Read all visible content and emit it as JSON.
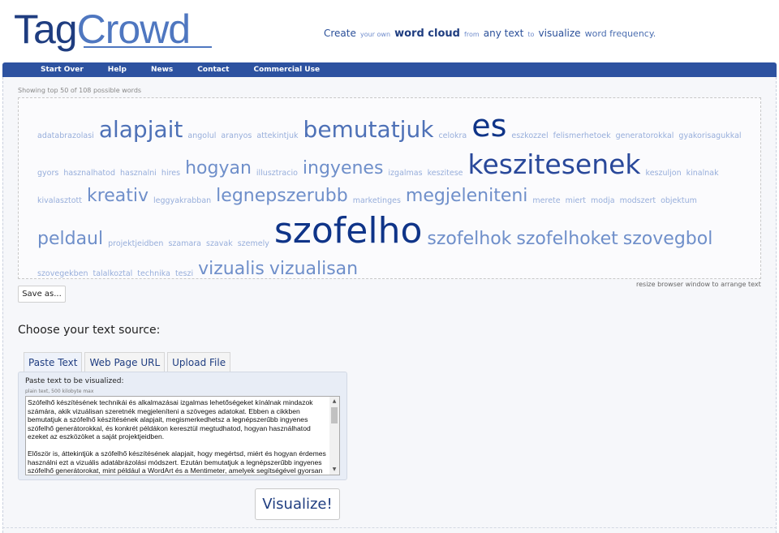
{
  "header": {
    "logo_tag": "Tag",
    "logo_crowd": "Crowd",
    "tagline": [
      {
        "text": "Create",
        "size": "xl"
      },
      {
        "text": "your own",
        "size": "sm"
      },
      {
        "text": "word cloud",
        "size": "lg"
      },
      {
        "text": "from",
        "size": "sm"
      },
      {
        "text": "any text",
        "size": "xl"
      },
      {
        "text": "to",
        "size": "sm"
      },
      {
        "text": "visualize",
        "size": "xl"
      },
      {
        "text": "word frequency.",
        "size": "md"
      }
    ]
  },
  "nav": {
    "items": [
      "Start Over",
      "Help",
      "News",
      "Contact",
      "Commercial Use"
    ]
  },
  "cloud": {
    "showing": "Showing top 50 of 108 possible words",
    "resize_note": "resize browser window to arrange text",
    "words": [
      {
        "text": "adatabrazolasi",
        "weight": 1
      },
      {
        "text": "alapjait",
        "weight": 6
      },
      {
        "text": "angolul",
        "weight": 1
      },
      {
        "text": "aranyos",
        "weight": 1
      },
      {
        "text": "attekintjuk",
        "weight": 1
      },
      {
        "text": "bemutatjuk",
        "weight": 7
      },
      {
        "text": "celokra",
        "weight": 1
      },
      {
        "text": "es",
        "weight": 9
      },
      {
        "text": "eszkozzel",
        "weight": 1
      },
      {
        "text": "felismerhetoek",
        "weight": 1
      },
      {
        "text": "generatorokkal",
        "weight": 1
      },
      {
        "text": "gyakorisagukkal",
        "weight": 1
      },
      {
        "text": "gyors",
        "weight": 1
      },
      {
        "text": "hasznalhatod",
        "weight": 1
      },
      {
        "text": "hasznalni",
        "weight": 1
      },
      {
        "text": "hires",
        "weight": 1
      },
      {
        "text": "hogyan",
        "weight": 5
      },
      {
        "text": "illusztracio",
        "weight": 1
      },
      {
        "text": "ingyenes",
        "weight": 5
      },
      {
        "text": "izgalmas",
        "weight": 1
      },
      {
        "text": "keszitese",
        "weight": 1
      },
      {
        "text": "keszitesenek",
        "weight": 8
      },
      {
        "text": "keszuljon",
        "weight": 1
      },
      {
        "text": "kinalnak",
        "weight": 1
      },
      {
        "text": "kivalasztott",
        "weight": 1
      },
      {
        "text": "kreativ",
        "weight": 5
      },
      {
        "text": "leggyakrabban",
        "weight": 1
      },
      {
        "text": "legnepszerubb",
        "weight": 5
      },
      {
        "text": "marketinges",
        "weight": 1
      },
      {
        "text": "megjeleniteni",
        "weight": 5
      },
      {
        "text": "merete",
        "weight": 1
      },
      {
        "text": "miert",
        "weight": 1
      },
      {
        "text": "modja",
        "weight": 1
      },
      {
        "text": "modszert",
        "weight": 1
      },
      {
        "text": "objektum",
        "weight": 1
      },
      {
        "text": "peldaul",
        "weight": 5
      },
      {
        "text": "projektjeidben",
        "weight": 1
      },
      {
        "text": "szamara",
        "weight": 1
      },
      {
        "text": "szavak",
        "weight": 1
      },
      {
        "text": "szemely",
        "weight": 1
      },
      {
        "text": "szofelho",
        "weight": 10
      },
      {
        "text": "szofelhok",
        "weight": 5
      },
      {
        "text": "szofelhoket",
        "weight": 5
      },
      {
        "text": "szovegbol",
        "weight": 5
      },
      {
        "text": "szovegekben",
        "weight": 1
      },
      {
        "text": "talalkoztal",
        "weight": 1
      },
      {
        "text": "technika",
        "weight": 1
      },
      {
        "text": "teszi",
        "weight": 1
      },
      {
        "text": "vizualis",
        "weight": 5
      },
      {
        "text": "vizualisan",
        "weight": 5
      }
    ]
  },
  "save_label": "Save as...",
  "choose_label": "Choose your text source:",
  "tabs": [
    "Paste Text",
    "Web Page URL",
    "Upload File"
  ],
  "paste": {
    "label": "Paste text to be visualized:",
    "sublabel": "plain text, 500 kilobyte max",
    "text": "Szófelhő készítésének technikái és alkalmazásai izgalmas lehetőségeket kínálnak mindazok számára, akik vizuálisan szeretnék megjeleníteni a szöveges adatokat. Ebben a cikkben bemutatjuk a szófelhő készítésének alapjait, megismerkedhetsz a legnépszerűbb ingyenes szófelhő generátorokkal, és konkrét példákon keresztül megtudhatod, hogyan használhatod ezeket az eszközöket a saját projektjeidben.\n\nElőször is, áttekintjük a szófelhő készítésének alapjait, hogy megértsd, miért és hogyan érdemes használni ezt a vizuális adatábrázolási módszert. Ezután bemutatjuk a legnépszerűbb ingyenes szófelhő generátorokat, mint például a WordArt és a Mentimeter, amelyek segítségével gyorsan és egyszerűen készíthetsz lenyűgöző szófelhőket."
  },
  "visualize_label": "Visualize!",
  "colors": {
    "nav_bg": "#2d52a0",
    "logo_dark": "#1f3d80",
    "logo_light": "#4f77c0"
  }
}
